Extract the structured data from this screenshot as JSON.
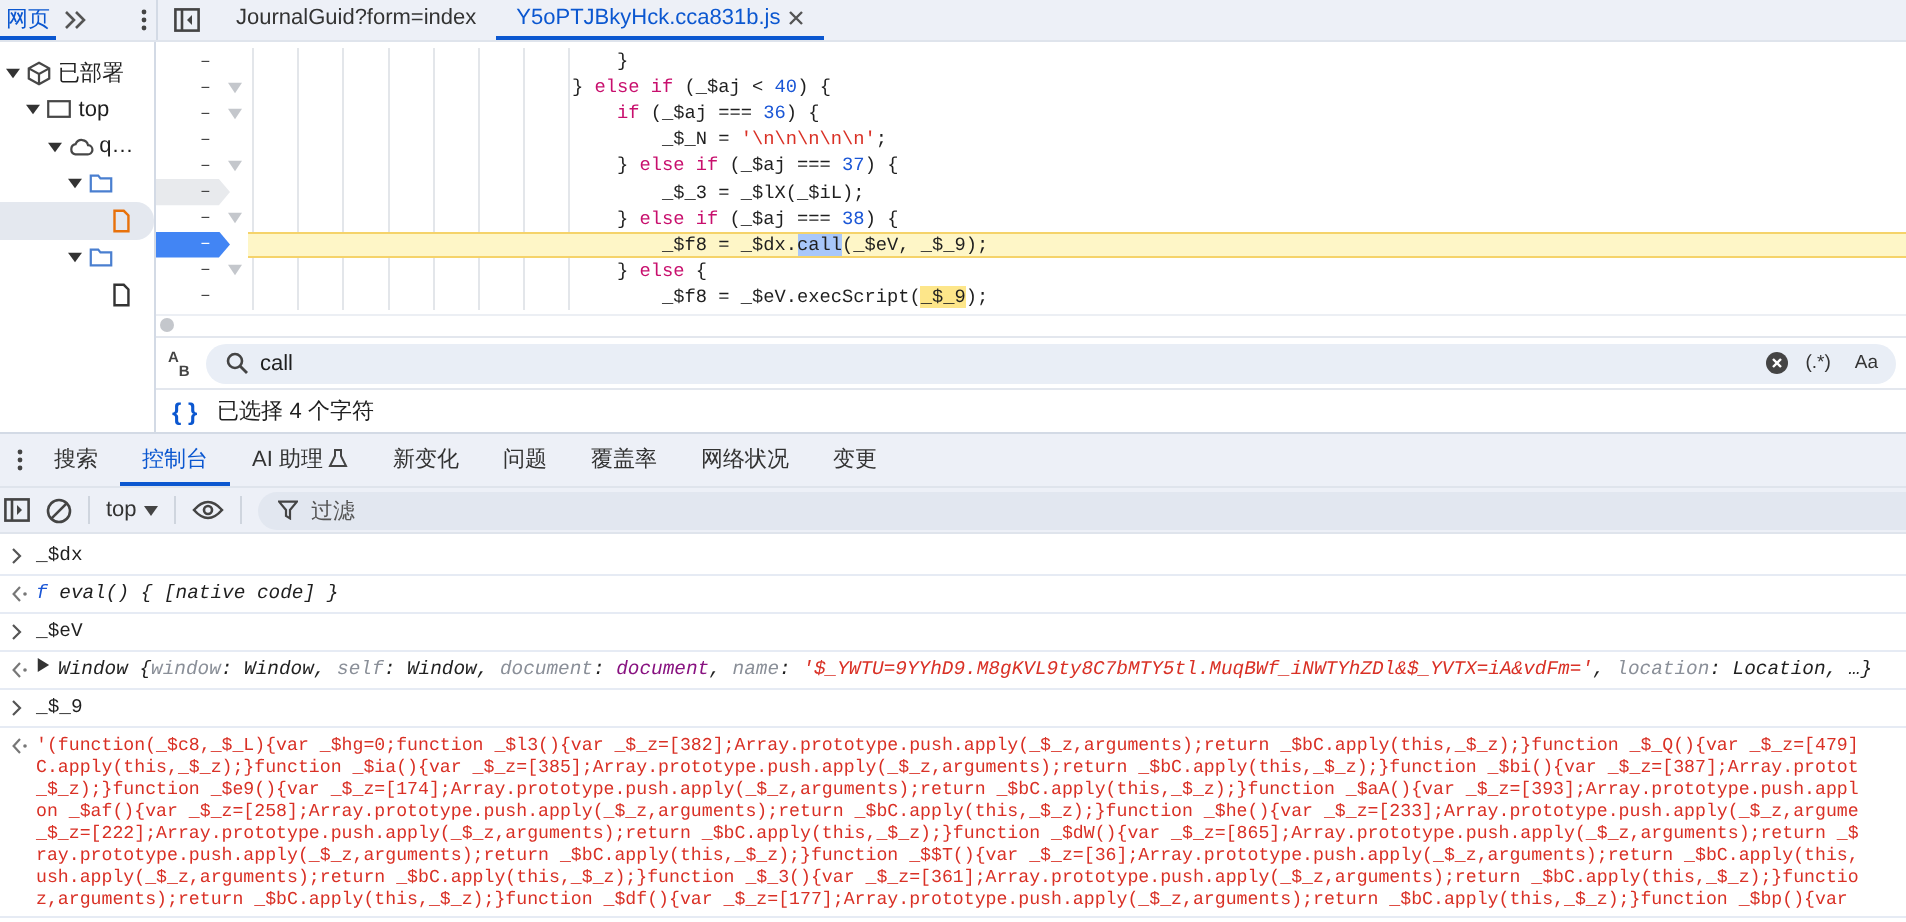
{
  "left_panel": {
    "tabs": [
      {
        "label": "网页",
        "selected": true
      }
    ]
  },
  "tree": [
    {
      "kind": "group",
      "label": "已部署",
      "expanded": true,
      "selected": false,
      "children": [
        {
          "kind": "frame",
          "label": "top",
          "expanded": true,
          "selected": false,
          "children": [
            {
              "kind": "domain",
              "label": "q…",
              "expanded": true,
              "selected": false,
              "children": [
                {
                  "kind": "folder",
                  "expanded": true,
                  "selected": false,
                  "children": [
                    {
                      "kind": "file",
                      "selected": true
                    }
                  ]
                },
                {
                  "kind": "folder",
                  "expanded": true,
                  "selected": false,
                  "children": [
                    {
                      "kind": "file",
                      "selected": false
                    }
                  ]
                }
              ]
            }
          ]
        }
      ]
    }
  ],
  "editor_tabs": [
    {
      "label": "JournalGuid?form=index",
      "selected": false,
      "closable": false
    },
    {
      "label": "Y5oPTJBkyHck.cca831b.js",
      "selected": true,
      "closable": true
    }
  ],
  "code_lines": [
    {
      "number": "–",
      "foldable": false,
      "breakpoint": false,
      "current": false,
      "tokens": [
        {
          "kind": "plain",
          "text": "    }"
        }
      ]
    },
    {
      "number": "–",
      "foldable": true,
      "breakpoint": false,
      "current": false,
      "tokens": [
        {
          "kind": "plain",
          "text": "} "
        },
        {
          "kind": "keyword",
          "text": "else if"
        },
        {
          "kind": "plain",
          "text": " (_$aj < "
        },
        {
          "kind": "number",
          "text": "40"
        },
        {
          "kind": "plain",
          "text": ") {"
        }
      ]
    },
    {
      "number": "–",
      "foldable": true,
      "breakpoint": false,
      "current": false,
      "tokens": [
        {
          "kind": "keyword",
          "text": "    if"
        },
        {
          "kind": "plain",
          "text": " (_$aj === "
        },
        {
          "kind": "number",
          "text": "36"
        },
        {
          "kind": "plain",
          "text": ") {"
        }
      ]
    },
    {
      "number": "–",
      "foldable": false,
      "breakpoint": false,
      "current": false,
      "tokens": [
        {
          "kind": "plain",
          "text": "        _$_N = "
        },
        {
          "kind": "string",
          "text": "'\\n\\n\\n\\n\\n'"
        },
        {
          "kind": "plain",
          "text": ";"
        }
      ]
    },
    {
      "number": "–",
      "foldable": true,
      "breakpoint": false,
      "current": false,
      "tokens": [
        {
          "kind": "plain",
          "text": "    } "
        },
        {
          "kind": "keyword",
          "text": "else if"
        },
        {
          "kind": "plain",
          "text": " (_$aj === "
        },
        {
          "kind": "number",
          "text": "37"
        },
        {
          "kind": "plain",
          "text": ") {"
        }
      ]
    },
    {
      "number": "–",
      "foldable": false,
      "breakpoint": true,
      "enabled": false,
      "current": false,
      "tokens": [
        {
          "kind": "plain",
          "text": "        _$_3 = _$lX(_$iL);"
        }
      ]
    },
    {
      "number": "–",
      "foldable": true,
      "breakpoint": false,
      "current": false,
      "tokens": [
        {
          "kind": "plain",
          "text": "    } "
        },
        {
          "kind": "keyword",
          "text": "else if"
        },
        {
          "kind": "plain",
          "text": " (_$aj === "
        },
        {
          "kind": "number",
          "text": "38"
        },
        {
          "kind": "plain",
          "text": ") {"
        }
      ]
    },
    {
      "number": "–",
      "foldable": false,
      "breakpoint": true,
      "enabled": true,
      "current": true,
      "tokens": [
        {
          "kind": "plain",
          "text": "        _$f8 = _$dx."
        },
        {
          "kind": "match",
          "text": "call"
        },
        {
          "kind": "plain",
          "text": "(_$eV, _$_9);"
        }
      ]
    },
    {
      "number": "–",
      "foldable": true,
      "breakpoint": false,
      "current": false,
      "tokens": [
        {
          "kind": "plain",
          "text": "    } "
        },
        {
          "kind": "keyword",
          "text": "else"
        },
        {
          "kind": "plain",
          "text": " {"
        }
      ]
    },
    {
      "number": "–",
      "foldable": false,
      "breakpoint": false,
      "current": false,
      "tokens": [
        {
          "kind": "plain",
          "text": "        _$f8 = _$eV.execScript("
        },
        {
          "kind": "occurrence",
          "text": "_$_9"
        },
        {
          "kind": "plain",
          "text": ");"
        }
      ]
    }
  ],
  "search": {
    "replace_toggle": [
      "A",
      "B"
    ],
    "value": "call",
    "toggles": [
      {
        "label": "(.*)",
        "selected": false
      },
      {
        "label": "Aa",
        "selected": false
      }
    ]
  },
  "status": {
    "format_icon": "{ }",
    "text": "已选择 4 个字符"
  },
  "drawer_tabs": [
    {
      "label": "搜索",
      "kind": "plain",
      "selected": false
    },
    {
      "label": "控制台",
      "kind": "plain",
      "selected": true
    },
    {
      "label": "AI 助理",
      "kind": "ai",
      "selected": false
    },
    {
      "label": "新变化",
      "kind": "plain",
      "selected": false
    },
    {
      "label": "问题",
      "kind": "plain",
      "selected": false
    },
    {
      "label": "覆盖率",
      "kind": "plain",
      "selected": false
    },
    {
      "label": "网络状况",
      "kind": "plain",
      "selected": false
    },
    {
      "label": "变更",
      "kind": "plain",
      "selected": false
    }
  ],
  "console_toolbar": {
    "context": "top",
    "filter_placeholder": "过滤"
  },
  "console": [
    {
      "kind": "input",
      "tokens": [
        {
          "kind": "plain",
          "text": "_$dx"
        }
      ]
    },
    {
      "kind": "output",
      "tokens": [
        {
          "kind": "function",
          "text": "f"
        },
        {
          "kind": "italic",
          "text": " eval() { [native code] }"
        }
      ]
    },
    {
      "kind": "input",
      "tokens": [
        {
          "kind": "plain",
          "text": "_$eV"
        }
      ]
    },
    {
      "kind": "output",
      "expanded": false,
      "tokens": [
        {
          "kind": "italic",
          "text": "Window {"
        },
        {
          "kind": "key",
          "text": "window"
        },
        {
          "kind": "italic",
          "text": ": Window, "
        },
        {
          "kind": "key",
          "text": "self"
        },
        {
          "kind": "italic",
          "text": ": Window, "
        },
        {
          "kind": "key",
          "text": "document"
        },
        {
          "kind": "italic",
          "text": ": "
        },
        {
          "kind": "object",
          "text": "document"
        },
        {
          "kind": "italic",
          "text": ", "
        },
        {
          "kind": "key",
          "text": "name"
        },
        {
          "kind": "italic",
          "text": ": "
        },
        {
          "kind": "string",
          "text": "'$_YWTU=9YYhD9.M8gKVL9ty8C7bMTY5tl.MuqBWf_iNWTYhZDl&$_YVTX=iA&vdFm='"
        },
        {
          "kind": "italic",
          "text": ", "
        },
        {
          "kind": "key",
          "text": "location"
        },
        {
          "kind": "italic",
          "text": ": Location, …}"
        }
      ]
    },
    {
      "kind": "input",
      "tokens": [
        {
          "kind": "plain",
          "text": "_$_9"
        }
      ]
    },
    {
      "kind": "output",
      "lines": [
        "'(function(_$c8,_$_L){var _$hg=0;function _$l3(){var _$_z=[382];Array.prototype.push.apply(_$_z,arguments);return _$bC.apply(this,_$_z);}function _$_Q(){var _$_z=[479]",
        "C.apply(this,_$_z);}function _$ia(){var _$_z=[385];Array.prototype.push.apply(_$_z,arguments);return _$bC.apply(this,_$_z);}function _$bi(){var _$_z=[387];Array.protot",
        "_$_z);}function _$e9(){var _$_z=[174];Array.prototype.push.apply(_$_z,arguments);return _$bC.apply(this,_$_z);}function _$aA(){var _$_z=[393];Array.prototype.push.appl",
        "on _$af(){var _$_z=[258];Array.prototype.push.apply(_$_z,arguments);return _$bC.apply(this,_$_z);}function _$he(){var _$_z=[233];Array.prototype.push.apply(_$_z,argume",
        "_$_z=[222];Array.prototype.push.apply(_$_z,arguments);return _$bC.apply(this,_$_z);}function _$dW(){var _$_z=[865];Array.prototype.push.apply(_$_z,arguments);return _$",
        "ray.prototype.push.apply(_$_z,arguments);return _$bC.apply(this,_$_z);}function _$$T(){var _$_z=[36];Array.prototype.push.apply(_$_z,arguments);return _$bC.apply(this,",
        "ush.apply(_$_z,arguments);return _$bC.apply(this,_$_z);}function _$_3(){var _$_z=[361];Array.prototype.push.apply(_$_z,arguments);return _$bC.apply(this,_$_z);}functio",
        "z,arguments);return _$bC.apply(this,_$_z);}function _$df(){var _$_z=[177];Array.prototype.push.apply(_$_z,arguments);return _$bC.apply(this,_$_z);}function _$bp(){var"
      ]
    }
  ]
}
